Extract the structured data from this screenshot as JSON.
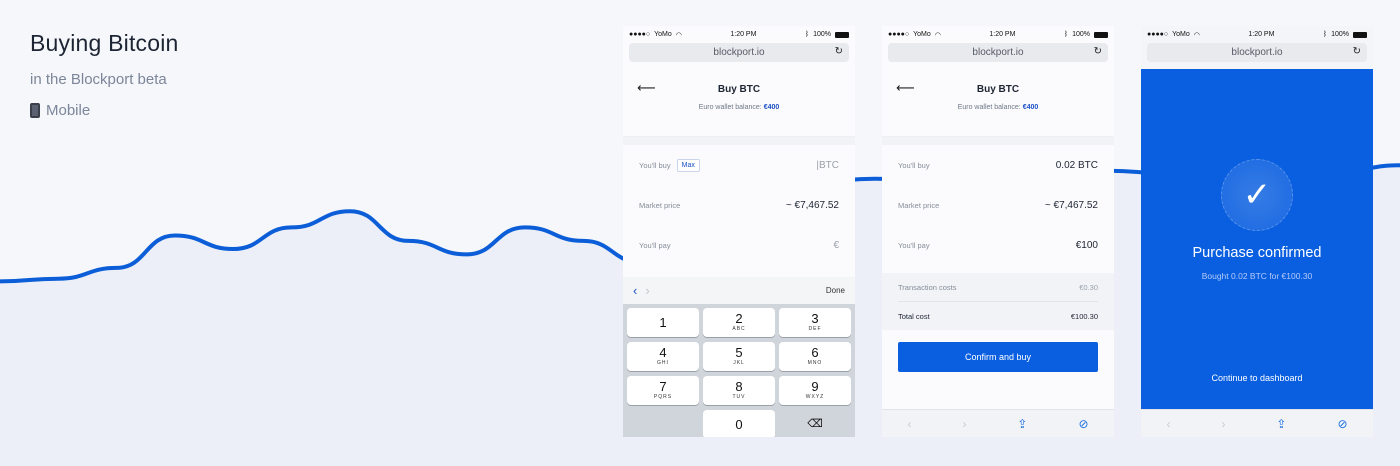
{
  "intro": {
    "title": "Buying Bitcoin",
    "subtitle": "in the Blockport beta",
    "device": "Mobile"
  },
  "colors": {
    "accent": "#0a5fe0",
    "line": "#0b5ed7",
    "background": "#f5f7fb"
  },
  "price_line": {
    "note": "decorative price trend line behind the screens",
    "values": [
      0.18,
      0.19,
      0.23,
      0.35,
      0.3,
      0.38,
      0.44,
      0.33,
      0.28,
      0.38,
      0.33,
      0.25,
      0.44,
      0.52,
      0.55,
      0.56,
      0.55,
      0.56,
      0.58,
      0.59,
      0.58,
      0.53,
      0.55,
      0.59,
      0.61
    ]
  },
  "status_bar": {
    "carrier": "YoMo",
    "time": "1:20 PM",
    "battery": "100%"
  },
  "url": "blockport.io",
  "screens": [
    {
      "title": "Buy BTC",
      "balance_label": "Euro wallet balance:",
      "balance_value": "€400",
      "rows": [
        {
          "label": "You'll buy",
          "value": "|BTC",
          "max": "Max"
        },
        {
          "label": "Market price",
          "value": "~ €7,467.52"
        },
        {
          "label": "You'll pay",
          "value": "€"
        }
      ],
      "keyboard": {
        "done": "Done",
        "keys": [
          {
            "n": "1",
            "t": ""
          },
          {
            "n": "2",
            "t": "ABC"
          },
          {
            "n": "3",
            "t": "DEF"
          },
          {
            "n": "4",
            "t": "GHI"
          },
          {
            "n": "5",
            "t": "JKL"
          },
          {
            "n": "6",
            "t": "MNO"
          },
          {
            "n": "7",
            "t": "PQRS"
          },
          {
            "n": "8",
            "t": "TUV"
          },
          {
            "n": "9",
            "t": "WXYZ"
          },
          {
            "n": "0",
            "t": ""
          }
        ]
      }
    },
    {
      "title": "Buy BTC",
      "balance_label": "Euro wallet balance:",
      "balance_value": "€400",
      "rows": [
        {
          "label": "You'll buy",
          "value": "0.02 BTC"
        },
        {
          "label": "Market price",
          "value": "~ €7,467.52"
        },
        {
          "label": "You'll pay",
          "value": "€100"
        }
      ],
      "costs": [
        {
          "label": "Transaction costs",
          "value": "€0.30"
        },
        {
          "label": "Total cost",
          "value": "€100.30"
        }
      ],
      "cta": "Confirm and buy"
    },
    {
      "title": "Purchase confirmed",
      "subtitle": "Bought 0.02 BTC for €100.30",
      "cta": "Continue to dashboard"
    }
  ]
}
